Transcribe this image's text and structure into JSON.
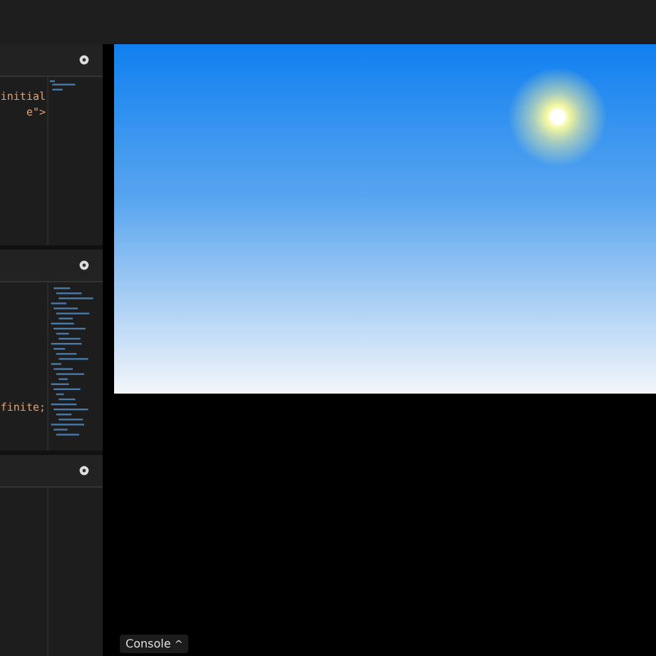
{
  "editors": [
    {
      "code_lines": [
        "initial",
        "e\">"
      ]
    },
    {
      "code_lines": [
        "finite;"
      ]
    }
  ],
  "console": {
    "label": "Console",
    "caret": "^"
  }
}
